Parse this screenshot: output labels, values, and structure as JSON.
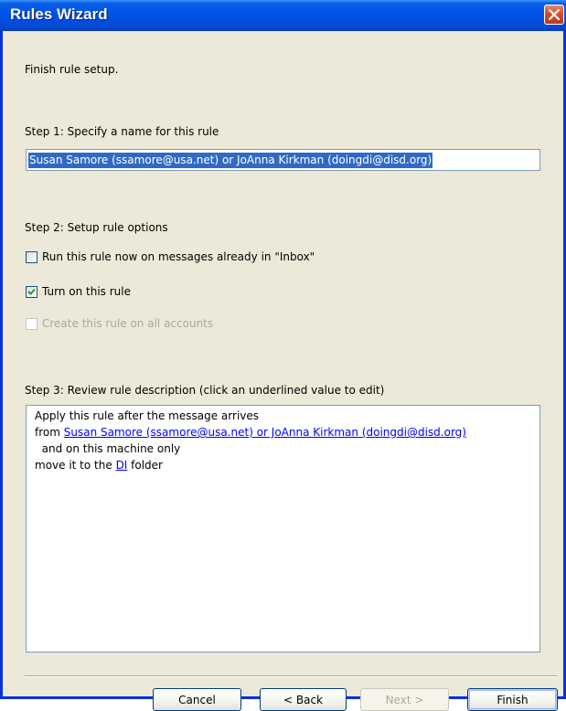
{
  "window": {
    "title": "Rules Wizard",
    "close_icon": "close-icon"
  },
  "header": {
    "text": "Finish rule setup."
  },
  "step1": {
    "label": "Step 1: Specify a name for this rule",
    "name_value": "Susan Samore (ssamore@usa.net) or JoAnna Kirkman (doingdi@disd.org)"
  },
  "step2": {
    "label": "Step 2: Setup rule options",
    "options": [
      {
        "label": "Run this rule now on messages already in \"Inbox\"",
        "checked": false,
        "enabled": true
      },
      {
        "label": "Turn on this rule",
        "checked": true,
        "enabled": true
      },
      {
        "label": "Create this rule on all accounts",
        "checked": false,
        "enabled": false
      }
    ]
  },
  "step3": {
    "label": "Step 3: Review rule description (click an underlined value to edit)",
    "lines": {
      "line1": "Apply this rule after the message arrives",
      "from_prefix": "from ",
      "from_link": "Susan Samore (ssamore@usa.net) or JoAnna Kirkman (doingdi@disd.org)",
      "line3": "  and on this machine only",
      "move_prefix": "move it to the ",
      "folder_link": "DI",
      "move_suffix": " folder"
    }
  },
  "buttons": {
    "cancel": "Cancel",
    "back": "< Back",
    "next": "Next >",
    "finish": "Finish"
  },
  "colors": {
    "titlebar": "#0050e8",
    "selection": "#316ac5",
    "link": "#0000ff",
    "dialog_bg": "#ece9d8"
  }
}
